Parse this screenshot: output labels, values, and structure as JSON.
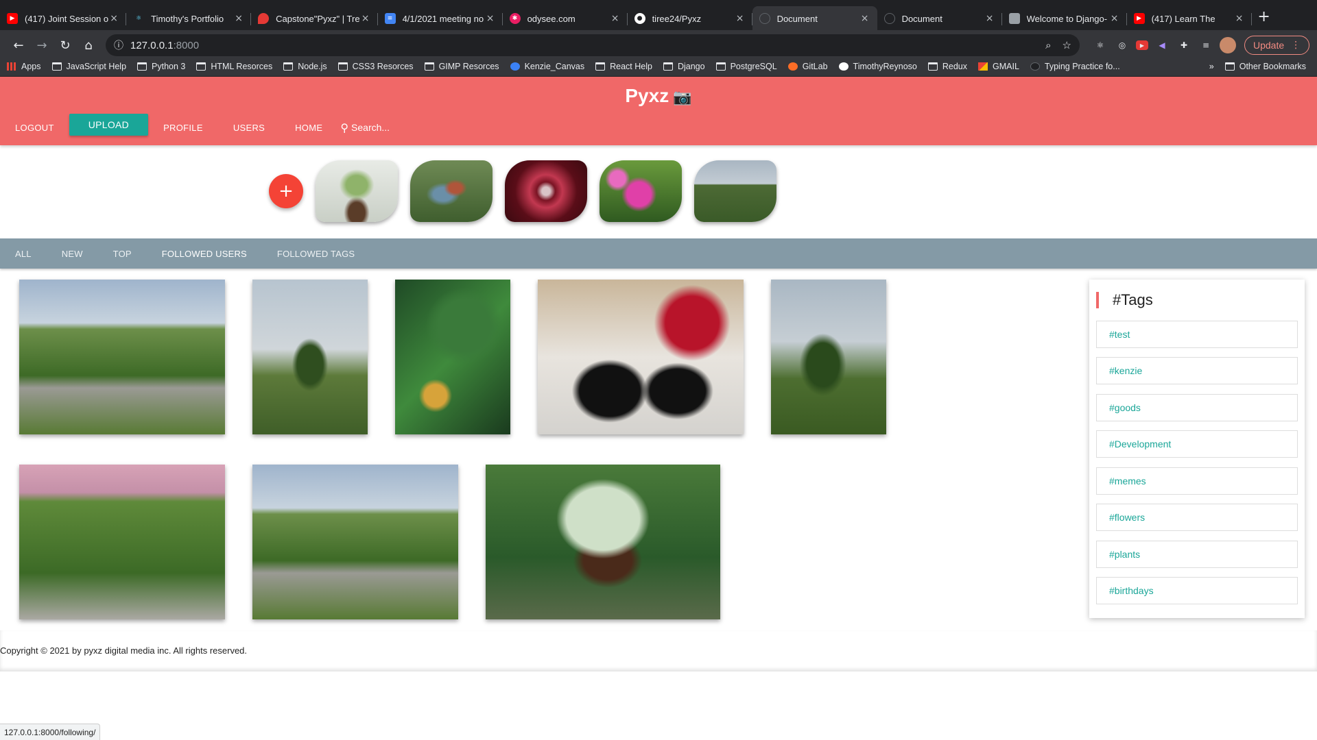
{
  "browser": {
    "tabs": [
      {
        "title": "(417) Joint Session o",
        "icon_color": "#ff0000",
        "icon": "youtube-icon"
      },
      {
        "title": "Timothy's Portfolio",
        "icon_color": "#61dafb",
        "icon": "react-icon"
      },
      {
        "title": "Capstone\"Pyxz\" | Tre",
        "icon_color": "#e53935",
        "icon": "map-pin-icon"
      },
      {
        "title": "4/1/2021 meeting no",
        "icon_color": "#4285f4",
        "icon": "docs-icon"
      },
      {
        "title": "odysee.com",
        "icon_color": "#e91e63",
        "icon": "odysee-icon"
      },
      {
        "title": "tiree24/Pyxz",
        "icon_color": "#ffffff",
        "icon": "github-icon"
      },
      {
        "title": "Document",
        "icon_color": "#5f6368",
        "icon": "globe-icon"
      },
      {
        "title": "Document",
        "icon_color": "#5f6368",
        "icon": "globe-icon"
      },
      {
        "title": "Welcome to Django-",
        "icon_color": "#9aa0a6",
        "icon": "django-icon"
      },
      {
        "title": "(417) Learn The",
        "icon_color": "#ff0000",
        "icon": "youtube-icon"
      }
    ],
    "active_tab": 6,
    "url_host": "127.0.0.1",
    "url_port": ":8000",
    "update_label": "Update",
    "bookmarks": [
      {
        "label": "Apps",
        "type": "apps"
      },
      {
        "label": "JavaScript Help",
        "type": "folder"
      },
      {
        "label": "Python 3",
        "type": "folder"
      },
      {
        "label": "HTML Resorces",
        "type": "folder"
      },
      {
        "label": "Node.js",
        "type": "folder"
      },
      {
        "label": "CSS3 Resorces",
        "type": "folder"
      },
      {
        "label": "GIMP Resorces",
        "type": "folder"
      },
      {
        "label": "Kenzie_Canvas",
        "type": "site"
      },
      {
        "label": "React Help",
        "type": "folder"
      },
      {
        "label": "Django",
        "type": "folder"
      },
      {
        "label": "PostgreSQL",
        "type": "folder"
      },
      {
        "label": "GitLab",
        "type": "site"
      },
      {
        "label": "TimothyReynoso",
        "type": "site"
      },
      {
        "label": "Redux",
        "type": "folder"
      },
      {
        "label": "GMAIL",
        "type": "site"
      },
      {
        "label": "Typing Practice fo...",
        "type": "site"
      }
    ],
    "bookmarks_overflow": "»",
    "other_bookmarks": "Other Bookmarks",
    "status_url": "127.0.0.1:8000/following/"
  },
  "site": {
    "brand": "Pyxz",
    "brand_icon": "📷",
    "nav": {
      "logout": "LOGOUT",
      "upload": "UPLOAD",
      "profile": "PROFILE",
      "users": "USERS",
      "home": "HOME",
      "search_placeholder": "Search..."
    },
    "add_story": "+",
    "filters": [
      "ALL",
      "NEW",
      "TOP",
      "FOLLOWED USERS",
      "FOLLOWED TAGS"
    ],
    "active_filter": "FOLLOWED USERS",
    "tags_title": "#Tags",
    "tags": [
      "#test",
      "#kenzie",
      "#goods",
      "#Development",
      "#memes",
      "#flowers",
      "#plants",
      "#birthdays"
    ],
    "copyright": "Copyright © 2021 by pyxz digital media inc. All rights reserved.",
    "colors": {
      "header": "#f06868",
      "accent": "#1aa698",
      "filterbar": "#849aa6",
      "add_button": "#f44336"
    }
  }
}
